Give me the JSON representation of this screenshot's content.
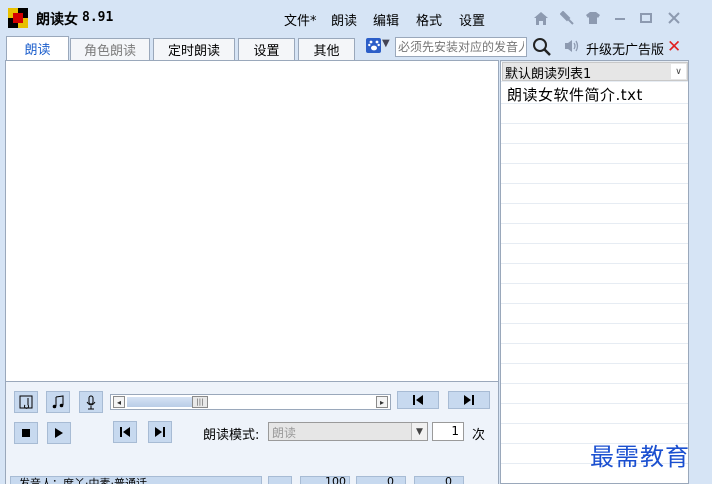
{
  "app": {
    "title": "朗读女",
    "version": "8.91"
  },
  "menu": [
    "文件*",
    "朗读",
    "编辑",
    "格式",
    "设置"
  ],
  "window_controls": [
    "home-icon",
    "pin-icon",
    "shirt-icon",
    "minimize-icon",
    "maximize-icon",
    "close-icon"
  ],
  "tabs": [
    {
      "label": "朗读",
      "active": true
    },
    {
      "label": "角色朗读",
      "active": false
    },
    {
      "label": "定时朗读",
      "active": false
    },
    {
      "label": "设置",
      "active": false
    },
    {
      "label": "其他",
      "active": false
    }
  ],
  "toolbar": {
    "voice_placeholder": "必须先安装对应的发音人",
    "upgrade_label": "升级无广告版"
  },
  "controls": {
    "mode_label": "朗读模式:",
    "mode_value": "朗读",
    "repeat_count": "1",
    "repeat_unit": "次",
    "slider_progress": 0.28
  },
  "status": {
    "speaker_text": "发音人：度丫·中素·普通话",
    "volume": "100",
    "speed": "0",
    "pitch": "0"
  },
  "playlist": {
    "selected_list": "默认朗读列表1",
    "items": [
      "朗读女软件简介.txt"
    ]
  },
  "watermark": "最需教育",
  "colors": {
    "frame": "#d6e4f5",
    "tab_active_text": "#1d5fcc",
    "close_red": "#e02020",
    "watermark": "#1a4fd0"
  }
}
